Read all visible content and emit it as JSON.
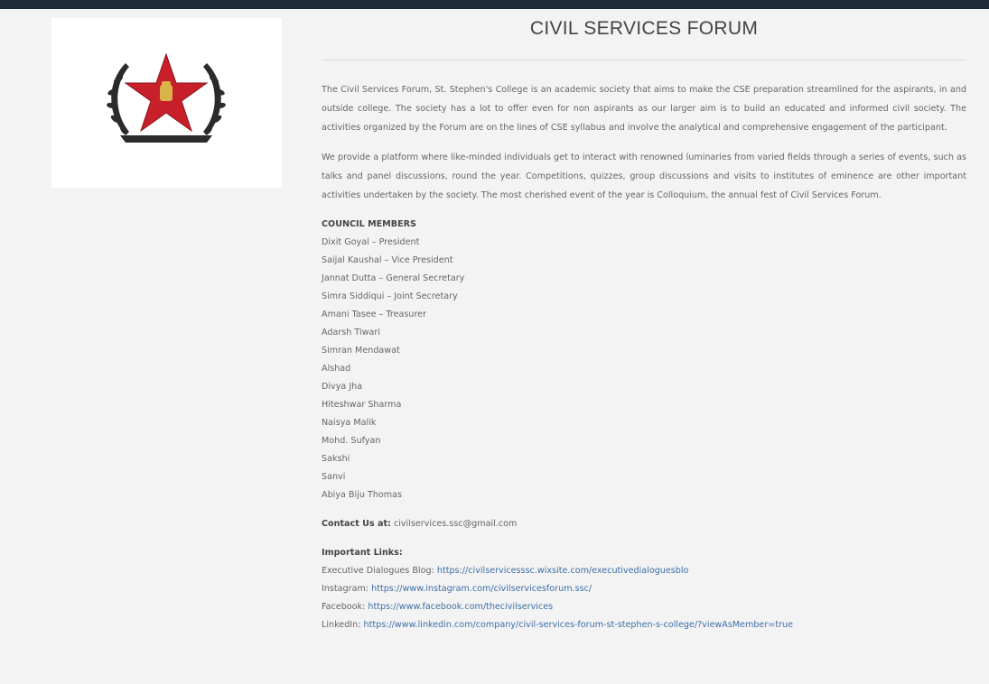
{
  "page": {
    "title": "CIVIL SERVICES FORUM"
  },
  "logo": {
    "icon": "star-emblem-with-laurel-wreath",
    "star_color": "#c8202a",
    "wreath_color": "#2b2b2b"
  },
  "intro": {
    "paragraph1": "The Civil Services Forum, St. Stephen's College is an academic society that aims to make the CSE preparation streamlined for the aspirants, in and outside college. The society has a lot to offer even for non aspirants as our larger aim is to build an educated and informed civil society. The activities organized by the Forum are on the lines of CSE syllabus and involve the analytical and comprehensive engagement of the participant.",
    "paragraph2": "We provide a platform where like-minded individuals get to interact with renowned luminaries from varied fields through a series of events, such as talks and panel discussions, round the year. Competitions, quizzes, group discussions and visits to institutes of eminence are other important activities undertaken by the society. The most cherished event of the year is Colloquium, the annual fest of Civil Services Forum."
  },
  "council": {
    "heading": "COUNCIL MEMBERS",
    "members": [
      "Dixit Goyal – President",
      "Saijal Kaushal – Vice President",
      "Jannat Dutta – General Secretary",
      "Simra Siddiqui – Joint Secretary",
      "Amani Tasee – Treasurer",
      "Adarsh Tiwari",
      "Simran Mendawat",
      "Alshad",
      "Divya Jha",
      "Hiteshwar Sharma",
      "Naisya Malik",
      "Mohd. Sufyan",
      "Sakshi",
      "Sanvi",
      "Abiya Biju Thomas"
    ]
  },
  "contact": {
    "label": "Contact Us at:",
    "email": "civilservices.ssc@gmail.com"
  },
  "links": {
    "heading": "Important Links:",
    "items": [
      {
        "label": "Executive Dialogues Blog:",
        "url": "https://civilservicesssc.wixsite.com/executivedialoguesblo"
      },
      {
        "label": "Instagram:",
        "url": "https://www.instagram.com/civilservicesforum.ssc/"
      },
      {
        "label": "Facebook:",
        "url": "https://www.facebook.com/thecivilservices"
      },
      {
        "label": "LinkedIn:",
        "url": "https://www.linkedin.com/company/civil-services-forum-st-stephen-s-college/?viewAsMember=true"
      }
    ]
  }
}
